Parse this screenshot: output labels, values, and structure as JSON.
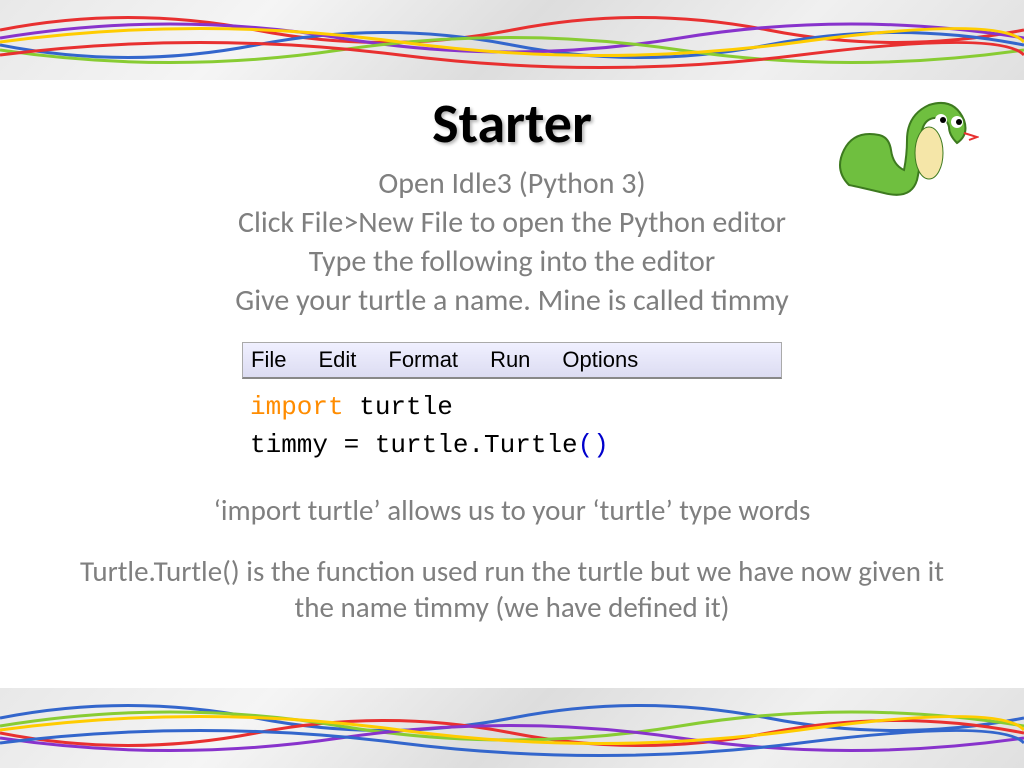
{
  "title": "Starter",
  "instructions": {
    "line1": "Open Idle3 (Python 3)",
    "line2": "Click File>New File to open the Python editor",
    "line3": "Type the following into the editor",
    "line4": "Give your turtle a name. Mine is called timmy"
  },
  "idle": {
    "menu": {
      "file": "File",
      "edit": "Edit",
      "format": "Format",
      "run": "Run",
      "options": "Options"
    },
    "code": {
      "import_kw": "import",
      "import_mod": " turtle",
      "line2a": "timmy = turtle.Turtle",
      "line2b": "()"
    }
  },
  "explain": {
    "line1": "‘import turtle’ allows us to your ‘turtle’ type words",
    "line2": "Turtle.Turtle() is the function used run the turtle but we have now given it the name timmy (we have defined it)"
  }
}
